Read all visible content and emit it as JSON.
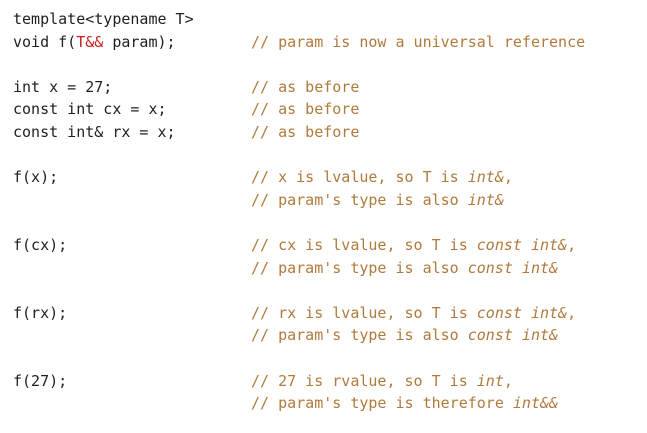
{
  "lines": [
    {
      "code": "template<typename T>",
      "comment": ""
    },
    {
      "code_pre": "void f(",
      "code_hl": "T&&",
      "code_post": " param);",
      "comment": "// param is now a universal reference"
    },
    {
      "code": "int x = 27;",
      "comment": "// as before"
    },
    {
      "code": "const int cx = x;",
      "comment": "// as before"
    },
    {
      "code": "const int& rx = x;",
      "comment": "// as before"
    },
    {
      "code": "f(x);",
      "comment_pre": "// x is lvalue, so T is ",
      "comment_it": "int&",
      "comment_post": ","
    },
    {
      "code": "",
      "comment_pre": "// param's type is also ",
      "comment_it": "int&",
      "comment_post": ""
    },
    {
      "code": "f(cx);",
      "comment_pre": "// cx is lvalue, so T is ",
      "comment_it": "const int&",
      "comment_post": ","
    },
    {
      "code": "",
      "comment_pre": "// param's type is also ",
      "comment_it": "const int&",
      "comment_post": ""
    },
    {
      "code": "f(rx);",
      "comment_pre": "// rx is lvalue, so T is ",
      "comment_it": "const int&",
      "comment_post": ","
    },
    {
      "code": "",
      "comment_pre": "// param's type is also ",
      "comment_it": "const int&",
      "comment_post": ""
    },
    {
      "code": "f(27);",
      "comment_pre": "// 27 is rvalue, so T is ",
      "comment_it": "int",
      "comment_post": ","
    },
    {
      "code": "",
      "comment_pre": "// param's type is therefore ",
      "comment_it": "int&&",
      "comment_post": ""
    }
  ],
  "colors": {
    "code": "#1f1f1f",
    "comment": "#b07a3c",
    "highlight": "#c4221b",
    "background": "#ffffff"
  }
}
